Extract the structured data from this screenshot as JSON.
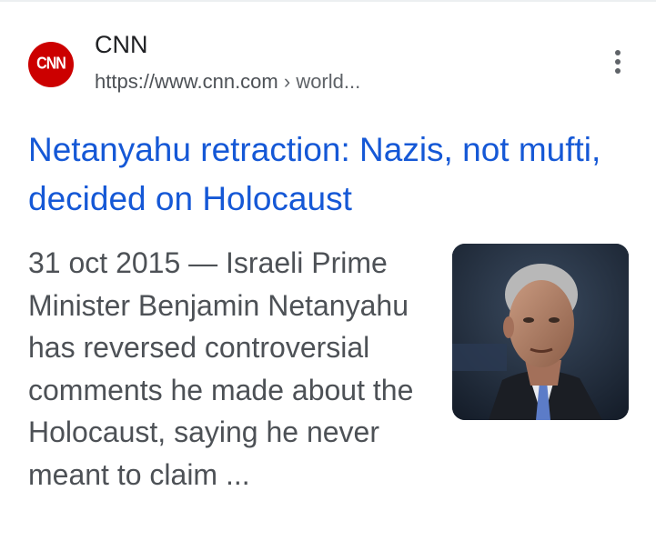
{
  "result": {
    "source": {
      "name": "CNN",
      "favicon_text": "CNN",
      "url_domain": "https://www.cnn.com",
      "url_separator": " › ",
      "url_path": "world...",
      "favicon_color": "#cc0000"
    },
    "menu_icon": "more-vert-icon",
    "title": "Netanyahu retraction: Nazis, not mufti, decided on Holocaust",
    "snippet_date": "31 oct 2015",
    "snippet_separator": " — ",
    "snippet_text": "Israeli Prime Minister Benjamin Netanyahu has reversed controversial comments he made about the Holocaust, saying he never meant to claim ...",
    "title_color": "#1558d6"
  }
}
